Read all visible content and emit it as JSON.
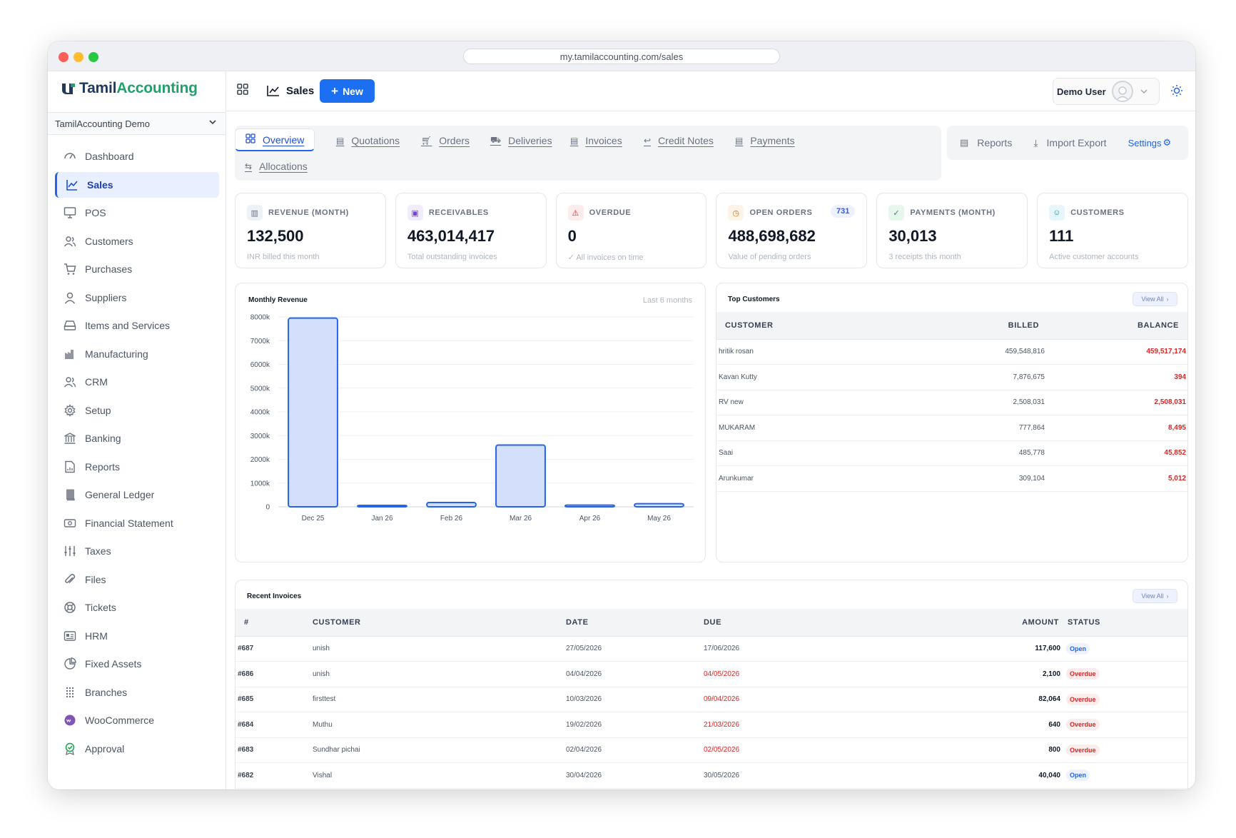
{
  "browser": {
    "url": "my.tamilaccounting.com/sales"
  },
  "brand": {
    "name_part1": "Tamil",
    "name_part2": "Accounting"
  },
  "sidebar": {
    "org": "TamilAccounting Demo",
    "items": [
      {
        "label": "Dashboard",
        "icon": "gauge-icon"
      },
      {
        "label": "Sales",
        "icon": "chart-line-icon",
        "active": true
      },
      {
        "label": "POS",
        "icon": "monitor-icon"
      },
      {
        "label": "Customers",
        "icon": "users-icon"
      },
      {
        "label": "Purchases",
        "icon": "cart-icon"
      },
      {
        "label": "Suppliers",
        "icon": "user-icon"
      },
      {
        "label": "Items and Services",
        "icon": "drive-icon"
      },
      {
        "label": "Manufacturing",
        "icon": "factory-icon"
      },
      {
        "label": "CRM",
        "icon": "users-icon"
      },
      {
        "label": "Setup",
        "icon": "gear-icon"
      },
      {
        "label": "Banking",
        "icon": "bank-icon"
      },
      {
        "label": "Reports",
        "icon": "report-icon"
      },
      {
        "label": "General Ledger",
        "icon": "book-icon"
      },
      {
        "label": "Financial Statement",
        "icon": "money-icon"
      },
      {
        "label": "Taxes",
        "icon": "sliders-icon"
      },
      {
        "label": "Files",
        "icon": "paperclip-icon"
      },
      {
        "label": "Tickets",
        "icon": "lifebuoy-icon"
      },
      {
        "label": "HRM",
        "icon": "id-card-icon"
      },
      {
        "label": "Fixed Assets",
        "icon": "pie-icon"
      },
      {
        "label": "Branches",
        "icon": "dots-grid-icon"
      },
      {
        "label": "WooCommerce",
        "icon": "woo-icon"
      },
      {
        "label": "Approval",
        "icon": "approval-icon"
      }
    ]
  },
  "topbar": {
    "title": "Sales",
    "new_label": "New",
    "user_name": "Demo User"
  },
  "tabs": [
    {
      "label": "Overview",
      "active": true
    },
    {
      "label": "Quotations"
    },
    {
      "label": "Orders"
    },
    {
      "label": "Deliveries"
    },
    {
      "label": "Invoices"
    },
    {
      "label": "Credit Notes"
    },
    {
      "label": "Payments"
    },
    {
      "label": "Allocations"
    }
  ],
  "right_tabs": {
    "reports": "Reports",
    "import_export": "Import Export",
    "settings": "Settings"
  },
  "kpis": [
    {
      "label": "REVENUE (MONTH)",
      "value": "132,500",
      "sub": "INR billed this month",
      "color": "#6b7280",
      "bg": "#eef2f7"
    },
    {
      "label": "RECEIVABLES",
      "value": "463,014,417",
      "sub": "Total outstanding invoices",
      "color": "#7c3aed",
      "bg": "#f1ecfd"
    },
    {
      "label": "OVERDUE",
      "value": "0",
      "sub": "✓ All invoices on time",
      "color": "#dc2626",
      "bg": "#fdecec"
    },
    {
      "label": "OPEN ORDERS",
      "value": "488,698,682",
      "sub": "Value of pending orders",
      "badge": "731",
      "color": "#d97706",
      "bg": "#fdf3e6"
    },
    {
      "label": "PAYMENTS (MONTH)",
      "value": "30,013",
      "sub": "3 receipts this month",
      "color": "#16a34a",
      "bg": "#e8f7ee"
    },
    {
      "label": "CUSTOMERS",
      "value": "111",
      "sub": "Active customer accounts",
      "color": "#0891b2",
      "bg": "#e6f6fa"
    }
  ],
  "revenue_card": {
    "title": "Monthly Revenue",
    "period": "Last 6 months"
  },
  "chart_data": {
    "type": "bar",
    "title": "Monthly Revenue",
    "categories": [
      "Dec 25",
      "Jan 26",
      "Feb 26",
      "Mar 26",
      "Apr 26",
      "May 26"
    ],
    "values": [
      7950000,
      40000,
      180000,
      2600000,
      70000,
      132500
    ],
    "ylim": [
      0,
      8000000
    ],
    "yticks": [
      0,
      1000000,
      2000000,
      3000000,
      4000000,
      5000000,
      6000000,
      7000000,
      8000000
    ],
    "ytick_labels": [
      "0",
      "1000k",
      "2000k",
      "3000k",
      "4000k",
      "5000k",
      "6000k",
      "7000k",
      "8000k"
    ],
    "grid": true,
    "bar_color": "#d4dffb",
    "bar_stroke": "#2563eb"
  },
  "top_customers": {
    "title": "Top Customers",
    "view_all": "View All",
    "headers": [
      "CUSTOMER",
      "BILLED",
      "BALANCE"
    ],
    "rows": [
      {
        "name": "hritik rosan",
        "billed": "459,548,816",
        "balance": "459,517,174"
      },
      {
        "name": "Kavan Kutty",
        "billed": "7,876,675",
        "balance": "394"
      },
      {
        "name": "RV new",
        "billed": "2,508,031",
        "balance": "2,508,031"
      },
      {
        "name": "MUKARAM",
        "billed": "777,864",
        "balance": "8,495"
      },
      {
        "name": "Saai",
        "billed": "485,778",
        "balance": "45,852"
      },
      {
        "name": "Arunkumar",
        "billed": "309,104",
        "balance": "5,012"
      }
    ]
  },
  "recent_invoices": {
    "title": "Recent Invoices",
    "view_all": "View All",
    "headers": [
      "#",
      "CUSTOMER",
      "DATE",
      "DUE",
      "AMOUNT",
      "STATUS"
    ],
    "rows": [
      {
        "no": "#687",
        "customer": "unish",
        "date": "27/05/2026",
        "due": "17/06/2026",
        "amount": "117,600",
        "status": "Open",
        "overdue": false
      },
      {
        "no": "#686",
        "customer": "unish",
        "date": "04/04/2026",
        "due": "04/05/2026",
        "amount": "2,100",
        "status": "Overdue",
        "overdue": true
      },
      {
        "no": "#685",
        "customer": "firsttest",
        "date": "10/03/2026",
        "due": "09/04/2026",
        "amount": "82,064",
        "status": "Overdue",
        "overdue": true
      },
      {
        "no": "#684",
        "customer": "Muthu",
        "date": "19/02/2026",
        "due": "21/03/2026",
        "amount": "640",
        "status": "Overdue",
        "overdue": true
      },
      {
        "no": "#683",
        "customer": "Sundhar pichai",
        "date": "02/04/2026",
        "due": "02/05/2026",
        "amount": "800",
        "status": "Overdue",
        "overdue": true
      },
      {
        "no": "#682",
        "customer": "Vishal",
        "date": "30/04/2026",
        "due": "30/05/2026",
        "amount": "40,040",
        "status": "Open",
        "overdue": false
      }
    ]
  },
  "colors": {
    "primary": "#1d6ff2",
    "danger": "#dc2626"
  }
}
